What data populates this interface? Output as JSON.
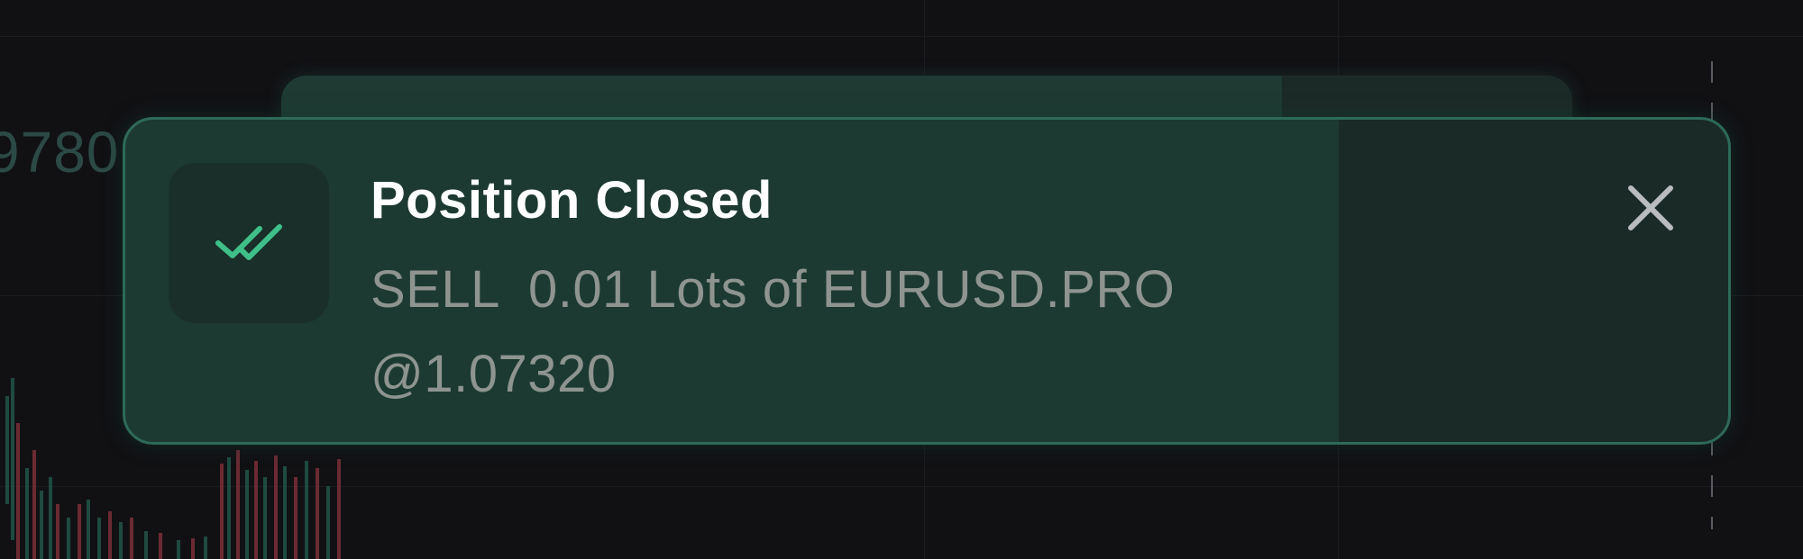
{
  "chart": {
    "price_label": "9780",
    "up_color": "#1f4a3f",
    "down_color": "#6b2a33"
  },
  "toast_back": {
    "accent": "#1e3a33"
  },
  "toast": {
    "icon": "double-check-icon",
    "icon_color": "#3fbf8a",
    "title": "Position Closed",
    "message": "SELL  0.01 Lots of EURUSD.PRO @1.07320",
    "close_icon": "close-icon",
    "border_color": "#2e6a58"
  }
}
